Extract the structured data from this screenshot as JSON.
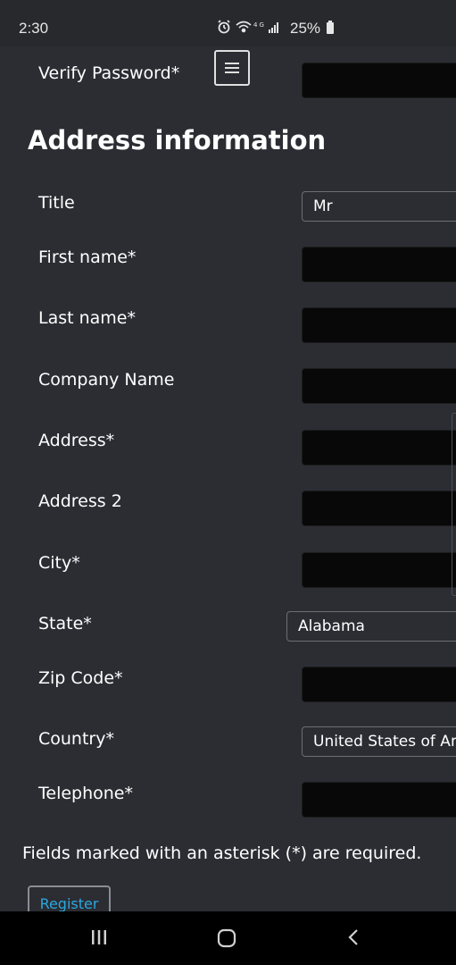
{
  "status_bar": {
    "time": "2:30",
    "icons": [
      "alarm-icon",
      "wifi-icon",
      "4g-icon",
      "signal-icon"
    ],
    "network_label": "4G",
    "battery": "25%"
  },
  "header": {
    "verify_password_label": "Verify Password*",
    "menu_icon": "hamburger-menu-icon"
  },
  "section": {
    "title": "Address information"
  },
  "form": {
    "title_label": "Title",
    "title_value": "Mr",
    "first_name_label": "First name*",
    "last_name_label": "Last name*",
    "company_label": "Company Name",
    "address_label": "Address*",
    "address2_label": "Address 2",
    "city_label": "City*",
    "state_label": "State*",
    "state_value": "Alabama",
    "zip_label": "Zip Code*",
    "country_label": "Country*",
    "country_value": "United States of Amer",
    "telephone_label": "Telephone*"
  },
  "footer": {
    "required_note": "Fields marked with an asterisk (*) are required.",
    "register_label": "Register"
  },
  "colors": {
    "background": "#2b2d33",
    "input_fill": "#080808",
    "link_blue": "#2aa8e0"
  },
  "nav_bar": {
    "icons": [
      "recent-apps-icon",
      "home-icon",
      "back-icon"
    ]
  }
}
